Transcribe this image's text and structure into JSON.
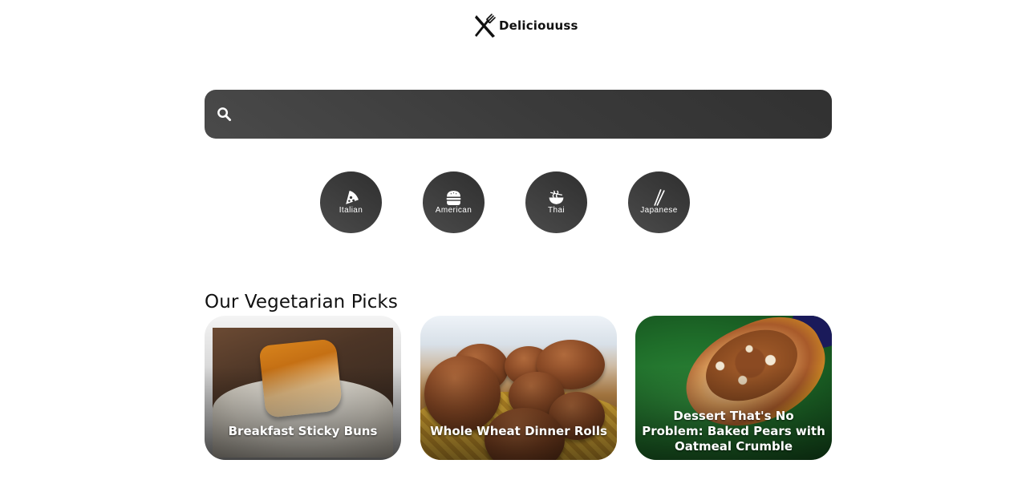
{
  "header": {
    "logo_text": "Deliciouuss",
    "logo_icon": "fork-knife-icon"
  },
  "search": {
    "value": "",
    "placeholder": "",
    "icon": "search-icon"
  },
  "categories": [
    {
      "label": "Italian",
      "icon": "pizza-icon"
    },
    {
      "label": "American",
      "icon": "hamburger-icon"
    },
    {
      "label": "Thai",
      "icon": "noodle-bowl-icon"
    },
    {
      "label": "Japanese",
      "icon": "chopsticks-icon"
    }
  ],
  "section": {
    "title": "Our Vegetarian Picks"
  },
  "cards": [
    {
      "title": "Breakfast Sticky Buns"
    },
    {
      "title": "Whole Wheat Dinner Rolls"
    },
    {
      "title": "Dessert That's No Problem: Baked Pears with Oatmeal Crumble"
    }
  ],
  "colors": {
    "dark_surface": "#3a3a3a",
    "text_dark": "#111111",
    "text_light": "#ffffff"
  }
}
